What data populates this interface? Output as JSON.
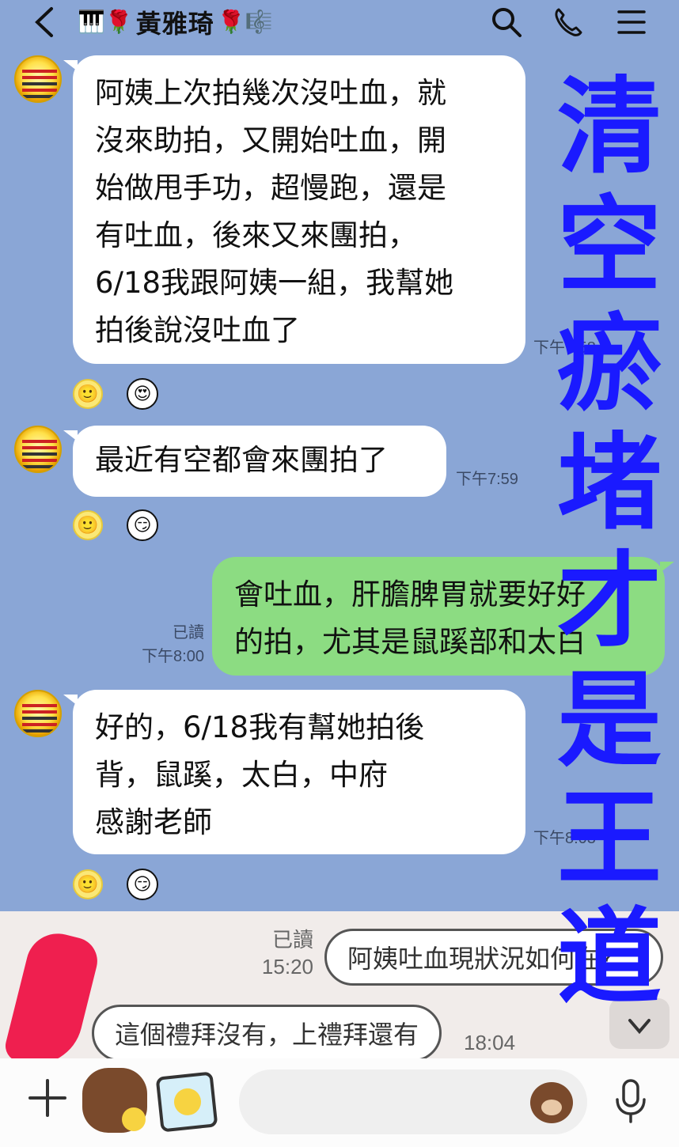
{
  "header": {
    "title": "黃雅琦",
    "title_prefix_emoji": "🎹🌹",
    "title_suffix_emoji": "🌹🎼"
  },
  "messages": [
    {
      "type": "incoming",
      "lines": [
        "阿姨上次拍幾次沒吐血，就",
        "沒來助拍，又開始吐血，開",
        "始做甩手功，超慢跑，還是",
        "有吐血，後來又來團拍，",
        "6/18我跟阿姨一組，我幫她",
        "拍後說沒吐血了"
      ],
      "time": "下午7:58"
    },
    {
      "type": "incoming",
      "lines": [
        "最近有空都會來團拍了"
      ],
      "time": "下午7:59"
    },
    {
      "type": "outgoing",
      "lines": [
        "會吐血，肝膽脾胃就要好好",
        "的拍，尤其是鼠蹊部和太白"
      ],
      "read": "已讀",
      "time": "下午8:00"
    },
    {
      "type": "incoming",
      "lines": [
        "好的，6/18我有幫她拍後",
        "背，鼠蹊，太白，中府",
        "感謝老師"
      ],
      "time": "下午8:03"
    }
  ],
  "reactions": [
    "🙂",
    "😍",
    "🙂",
    "😏",
    "🙂",
    "😏"
  ],
  "overlay_text": [
    "清",
    "空",
    "瘀",
    "堵",
    "才",
    "是",
    "王",
    "道"
  ],
  "embedded": {
    "read": "已讀",
    "read_time": "15:20",
    "outgoing_text": "阿姨吐血現狀況如何在？",
    "incoming_text": "這個禮拜沒有，上禮拜還有",
    "incoming_time": "18:04"
  },
  "colors": {
    "chat_bg": "#8aa6d6",
    "outgoing_bubble": "#8cdc82",
    "overlay_text": "#1a1aff"
  }
}
